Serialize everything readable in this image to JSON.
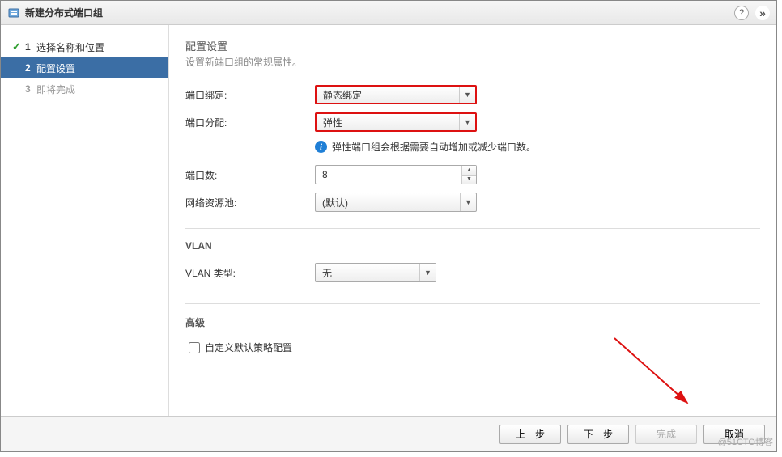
{
  "dialog": {
    "title": "新建分布式端口组"
  },
  "steps": [
    {
      "num": "1",
      "label": "选择名称和位置",
      "state": "done"
    },
    {
      "num": "2",
      "label": "配置设置",
      "state": "active"
    },
    {
      "num": "3",
      "label": "即将完成",
      "state": "pending"
    }
  ],
  "main": {
    "header": "配置设置",
    "sub": "设置新端口组的常规属性。",
    "port_binding_label": "端口绑定:",
    "port_binding_value": "静态绑定",
    "port_alloc_label": "端口分配:",
    "port_alloc_value": "弹性",
    "info_text": "弹性端口组会根据需要自动增加或减少端口数。",
    "port_count_label": "端口数:",
    "port_count_value": "8",
    "resource_pool_label": "网络资源池:",
    "resource_pool_value": "(默认)",
    "vlan_section": "VLAN",
    "vlan_type_label": "VLAN 类型:",
    "vlan_type_value": "无",
    "advanced_section": "高级",
    "custom_policy_label": "自定义默认策略配置"
  },
  "footer": {
    "back": "上一步",
    "next": "下一步",
    "finish": "完成",
    "cancel": "取消"
  },
  "watermark": "@51CTO博客"
}
